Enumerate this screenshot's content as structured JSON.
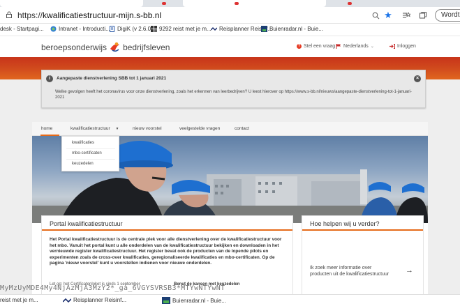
{
  "browser": {
    "url_prefix": "https://",
    "url_host": "kwalificatiestructuur-mijn.s-bb.nl",
    "profile_button": "Wordt niet"
  },
  "bookmarks": [
    "desk - Startpagi...",
    "Intranet - Introducti...",
    "DigiK (v 2.6.0)",
    "9292 reist met je m...",
    "Reisplanner Reisinf...",
    "Buienradar.nl - Buie..."
  ],
  "site": {
    "logo_text_1": "beroepsonderwijs",
    "logo_text_2": "bedrijfsleven",
    "util_question": "Stel een vraag",
    "util_language": "Nederlands",
    "util_login": "Inloggen"
  },
  "notice": {
    "title": "Aangepaste dienstverlening SBB tot 1 januari 2021",
    "body": "Welke gevolgen heeft het coronavirus voor onze dienstverlening, zoals het erkennen van leerbedrijven? U leest hierover op https://www.s-bb.nl/nieuws/aangepaste-dienstverlening-tot-1-januari-2021"
  },
  "nav": {
    "home": "home",
    "kwalificatiestructuur": "kwalificatiestructuur",
    "nieuw_voorstel": "nieuw voorstel",
    "faq": "veelgestelde vragen",
    "contact": "contact"
  },
  "dropdown": [
    "kwalificaties",
    "mbo-certificaten",
    "keuzedelen"
  ],
  "portal": {
    "title": "Portal kwalificatiestructuur",
    "body": "Het Portal kwalificatiestructuur is de centrale plek voor alle dienstverlening over de kwalificatiestructuur voor het mbo. Vanuit het portal kunt u alle onderdelen van de kwalificatiestructuur bekijken en downloaden in het vernieuwde register kwalificatiestructuur. Het register bevat ook de producten van de lopende pilots en experimenten zoals de cross-over kwalificaties, geregionaliseerde kwalificaties en mbo-certificaten. Op de pagina 'nieuw voorstel' kunt u voorstellen indienen voor nieuwe onderdelen.",
    "footnote_a": "Let op: het Certificatenloket is sinds 1 september",
    "footnote_b": "Benut de kansen met keuzedelen"
  },
  "help": {
    "title": "Hoe helpen wij u verder?",
    "link": "Ik zoek meer informatie over producten uit de kwalificatiestructuur"
  },
  "overlay": {
    "cookie_text": "MyMzUyMDE4My4NjAzMjA3MzY2*_ga_6VGYSVRSB3*MTYwNTYwNT",
    "strip_1": "reist met je m...",
    "strip_2": "Reisplanner Reisinf...",
    "strip_3": "Buienradar.nl - Buie..."
  },
  "colors": {
    "accent_orange": "#e56a18",
    "brand_red": "#c8341a"
  }
}
